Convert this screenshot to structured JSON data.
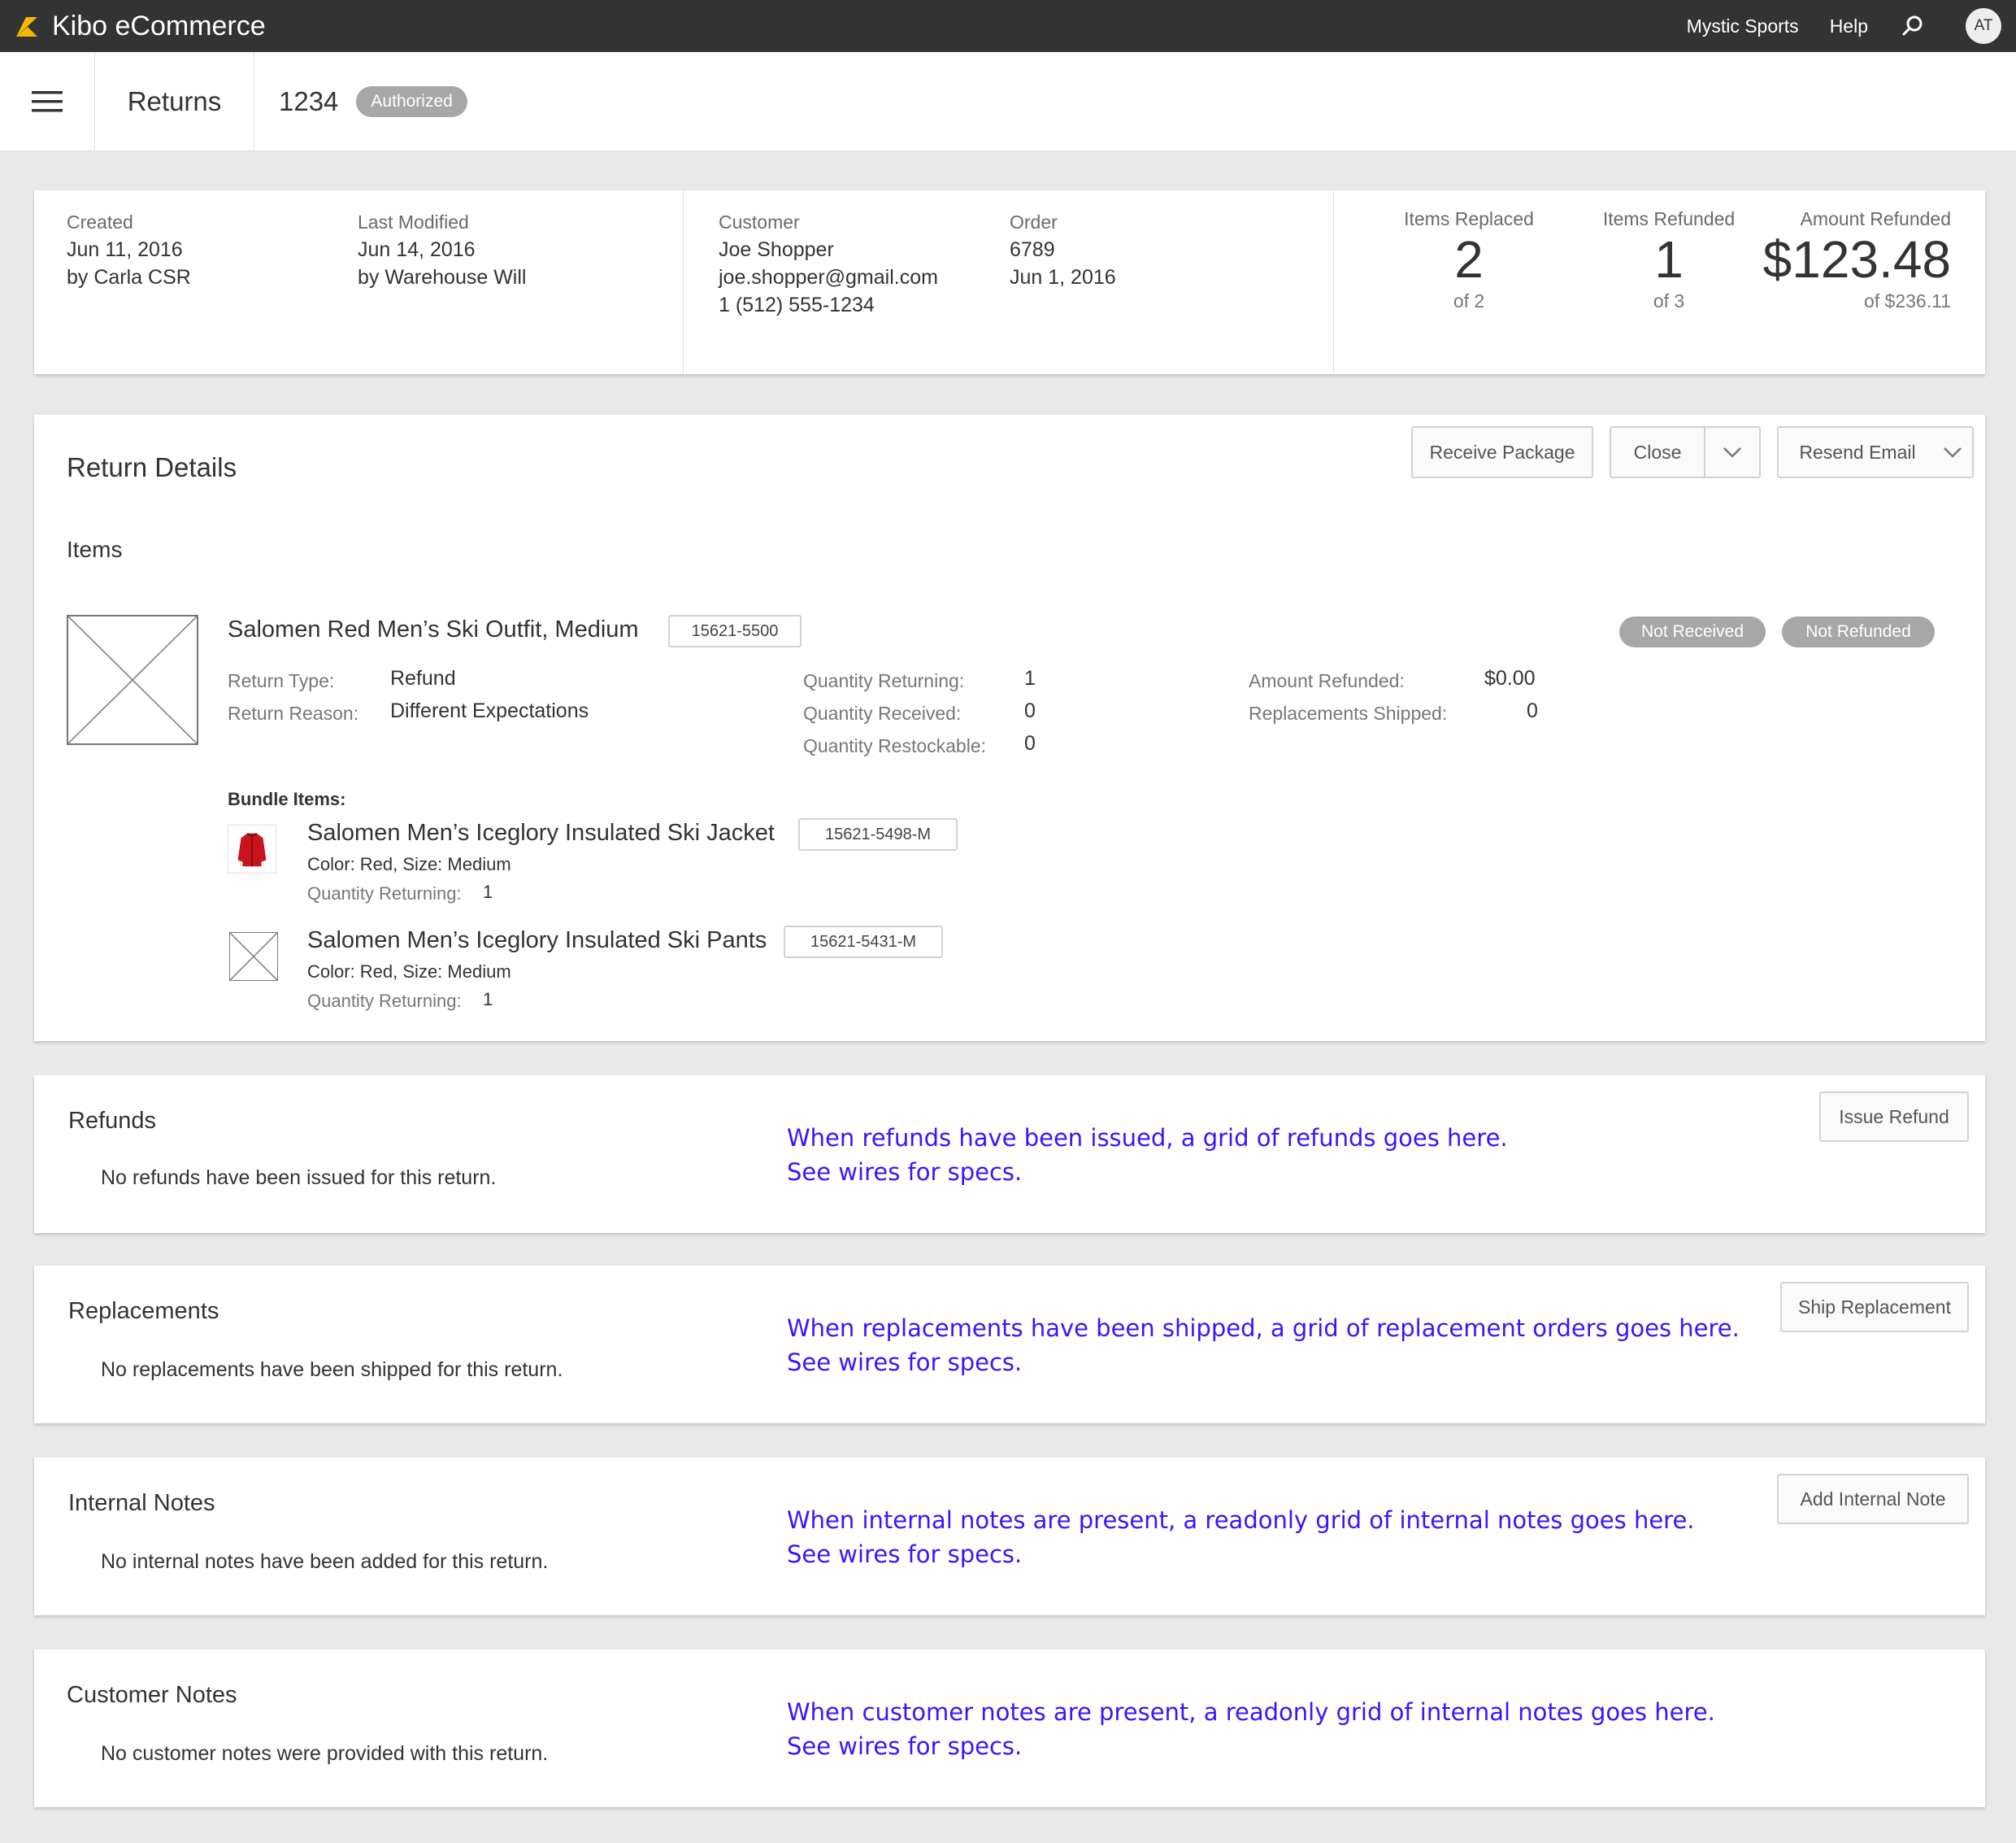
{
  "app": {
    "brand": "Kibo eCommerce",
    "tenant": "Mystic Sports",
    "help": "Help",
    "avatar_initials": "AT",
    "accent": "#f5b800"
  },
  "header": {
    "title": "Returns",
    "return_id": "1234",
    "status": "Authorized"
  },
  "summary": {
    "created_label": "Created",
    "created_date": "Jun 11, 2016",
    "created_by": "by Carla CSR",
    "modified_label": "Last Modified",
    "modified_date": "Jun 14, 2016",
    "modified_by": "by Warehouse Will",
    "customer_label": "Customer",
    "customer_name": "Joe Shopper",
    "customer_email": "joe.shopper@gmail.com",
    "customer_phone": "1 (512) 555-1234",
    "order_label": "Order",
    "order_number": "6789",
    "order_date": "Jun 1, 2016",
    "replaced_label": "Items Replaced",
    "replaced_value": "2",
    "replaced_of": "of 2",
    "refunded_label": "Items Refunded",
    "refunded_value": "1",
    "refunded_of": "of 3",
    "amount_label": "Amount Refunded",
    "amount_value": "$123.48",
    "amount_of": "of $236.11"
  },
  "details": {
    "title": "Return Details",
    "receive_btn": "Receive Package",
    "close_btn": "Close",
    "resend_btn": "Resend Email",
    "items_heading": "Items",
    "item": {
      "name": "Salomen Red Men’s Ski Outfit, Medium",
      "sku": "15621-5500",
      "badge_received": "Not Received",
      "badge_refunded": "Not Refunded",
      "return_type_label": "Return Type:",
      "return_type": "Refund",
      "return_reason_label": "Return Reason:",
      "return_reason": "Different Expectations",
      "qty_returning_label": "Quantity Returning:",
      "qty_returning": "1",
      "qty_received_label": "Quantity Received:",
      "qty_received": "0",
      "qty_restockable_label": "Quantity Restockable:",
      "qty_restockable": "0",
      "amount_refunded_label": "Amount Refunded:",
      "amount_refunded": "$0.00",
      "replacements_label": "Replacements Shipped:",
      "replacements": "0"
    },
    "bundle_heading": "Bundle Items:",
    "bundle": [
      {
        "name": "Salomen Men’s Iceglory Insulated Ski Jacket",
        "sku": "15621-5498-M",
        "attrs": "Color: Red, Size: Medium",
        "qty_label": "Quantity Returning:",
        "qty": "1"
      },
      {
        "name": "Salomen Men’s Iceglory Insulated Ski Pants",
        "sku": "15621-5431-M",
        "attrs": "Color: Red, Size: Medium",
        "qty_label": "Quantity Returning:",
        "qty": "1"
      }
    ]
  },
  "refunds": {
    "title": "Refunds",
    "button": "Issue Refund",
    "empty": "No refunds have been issued for this return.",
    "note_line1": "When refunds have been issued, a grid of refunds goes here.",
    "note_line2": "See wires for specs."
  },
  "replacements": {
    "title": "Replacements",
    "button": "Ship Replacement",
    "empty": "No replacements have been shipped for this return.",
    "note_line1": "When replacements have been shipped, a grid of replacement orders goes here.",
    "note_line2": "See wires for specs."
  },
  "internal_notes": {
    "title": "Internal Notes",
    "button": "Add Internal Note",
    "empty": "No internal notes have been added for this return.",
    "note_line1": "When internal notes are present, a readonly grid of internal notes goes here.",
    "note_line2": "See wires for specs."
  },
  "customer_notes": {
    "title": "Customer Notes",
    "empty": "No customer notes were provided with this return.",
    "note_line1": "When customer notes are present, a readonly grid of internal notes goes here.",
    "note_line2": "See wires for specs."
  }
}
